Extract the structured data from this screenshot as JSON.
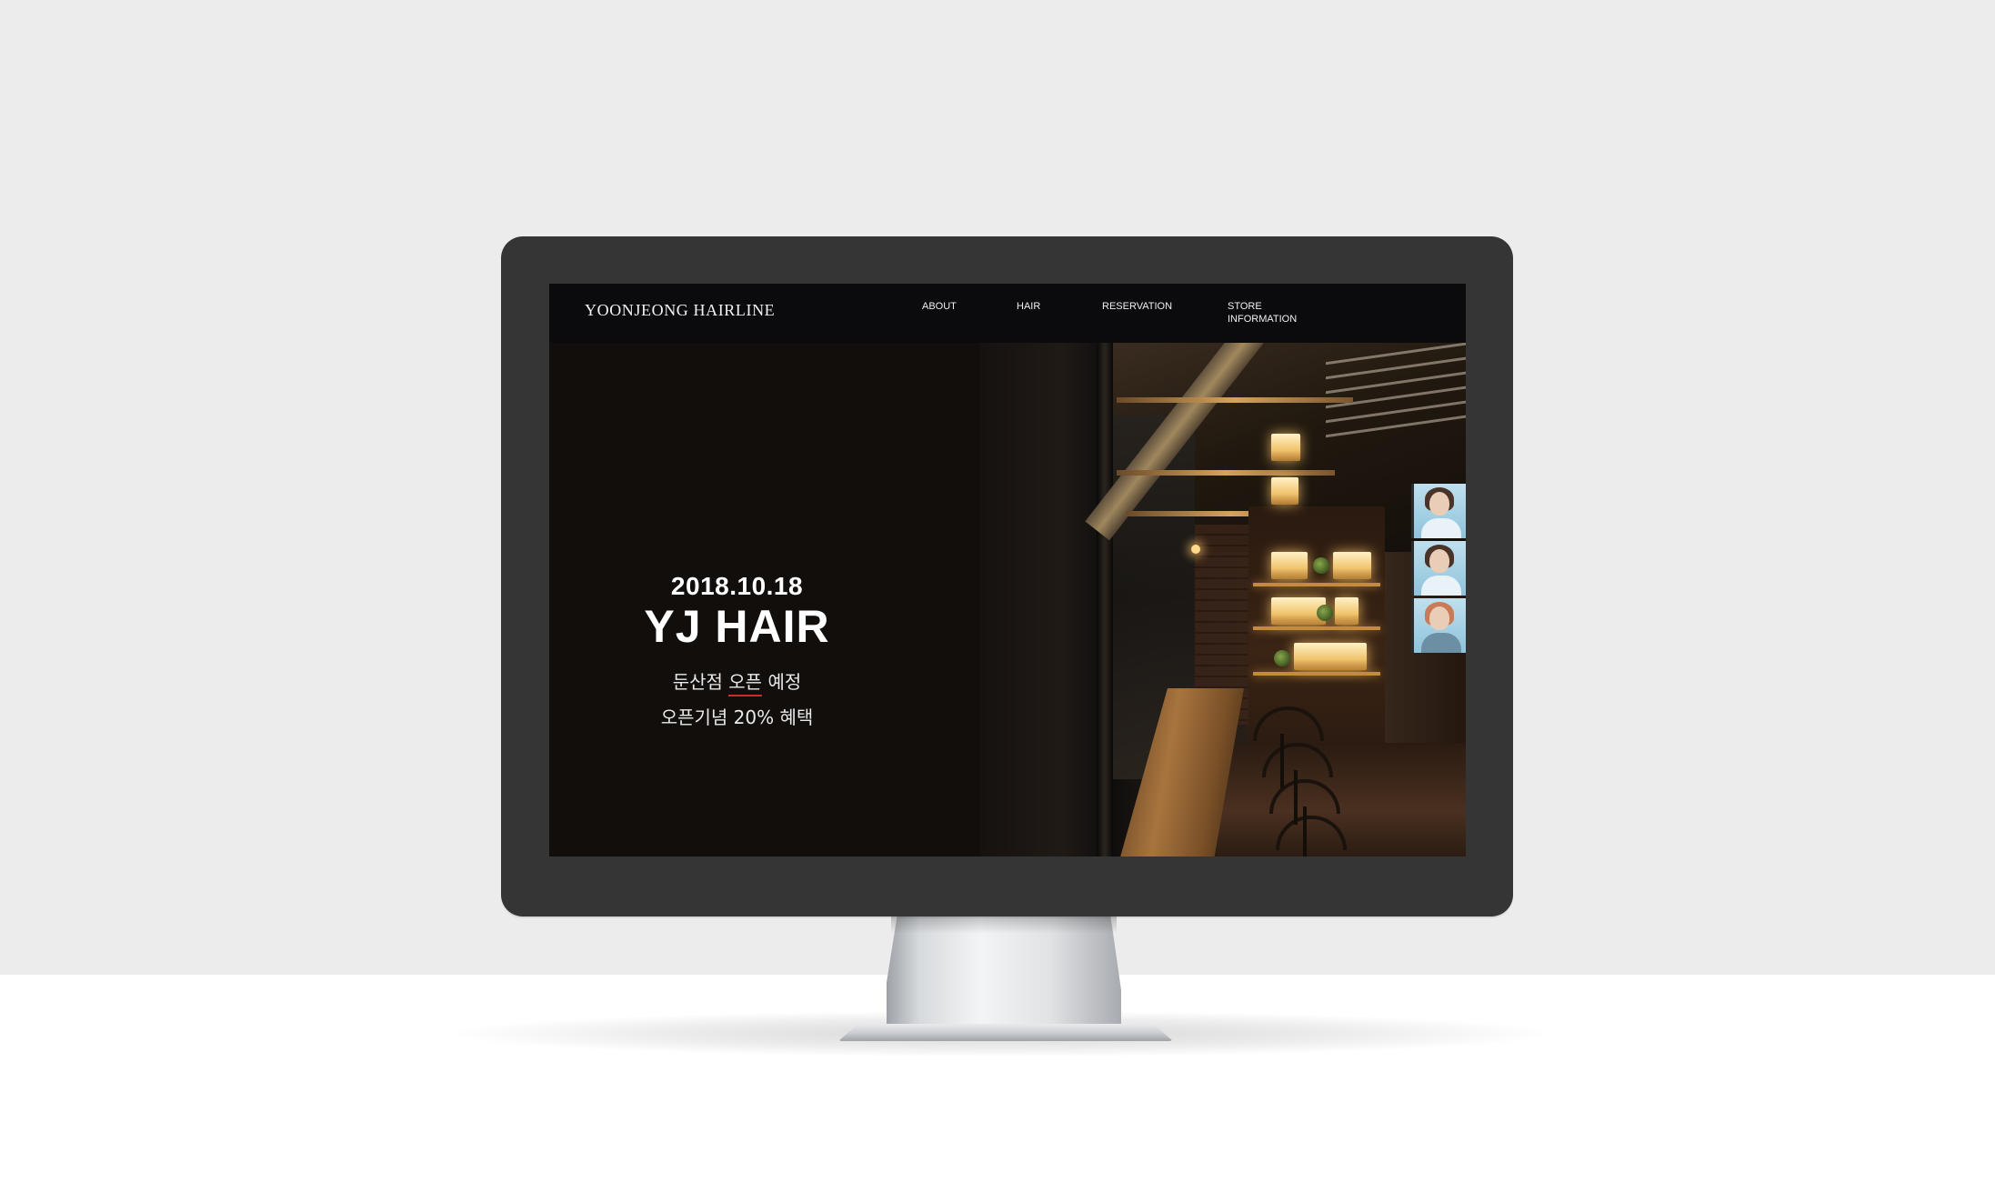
{
  "site": {
    "logo": "YOONJEONG HAIRLINE",
    "nav": [
      {
        "label": "ABOUT"
      },
      {
        "label": "HAIR"
      },
      {
        "label": "RESERVATION"
      },
      {
        "label": "STORE INFORMATION"
      }
    ]
  },
  "hero": {
    "date": "2018.10.18",
    "title": "YJ HAIR",
    "line1_prefix": "둔산점 ",
    "line1_highlight": "오픈",
    "line1_suffix": " 예정",
    "line2": "오픈기념 20% 혜택",
    "highlight_color": "#d22a2a"
  },
  "colors": {
    "wall": "#ececec",
    "bezel": "#353535",
    "header_bg": "#0b0b0d",
    "hero_bg": "#120e0c"
  }
}
